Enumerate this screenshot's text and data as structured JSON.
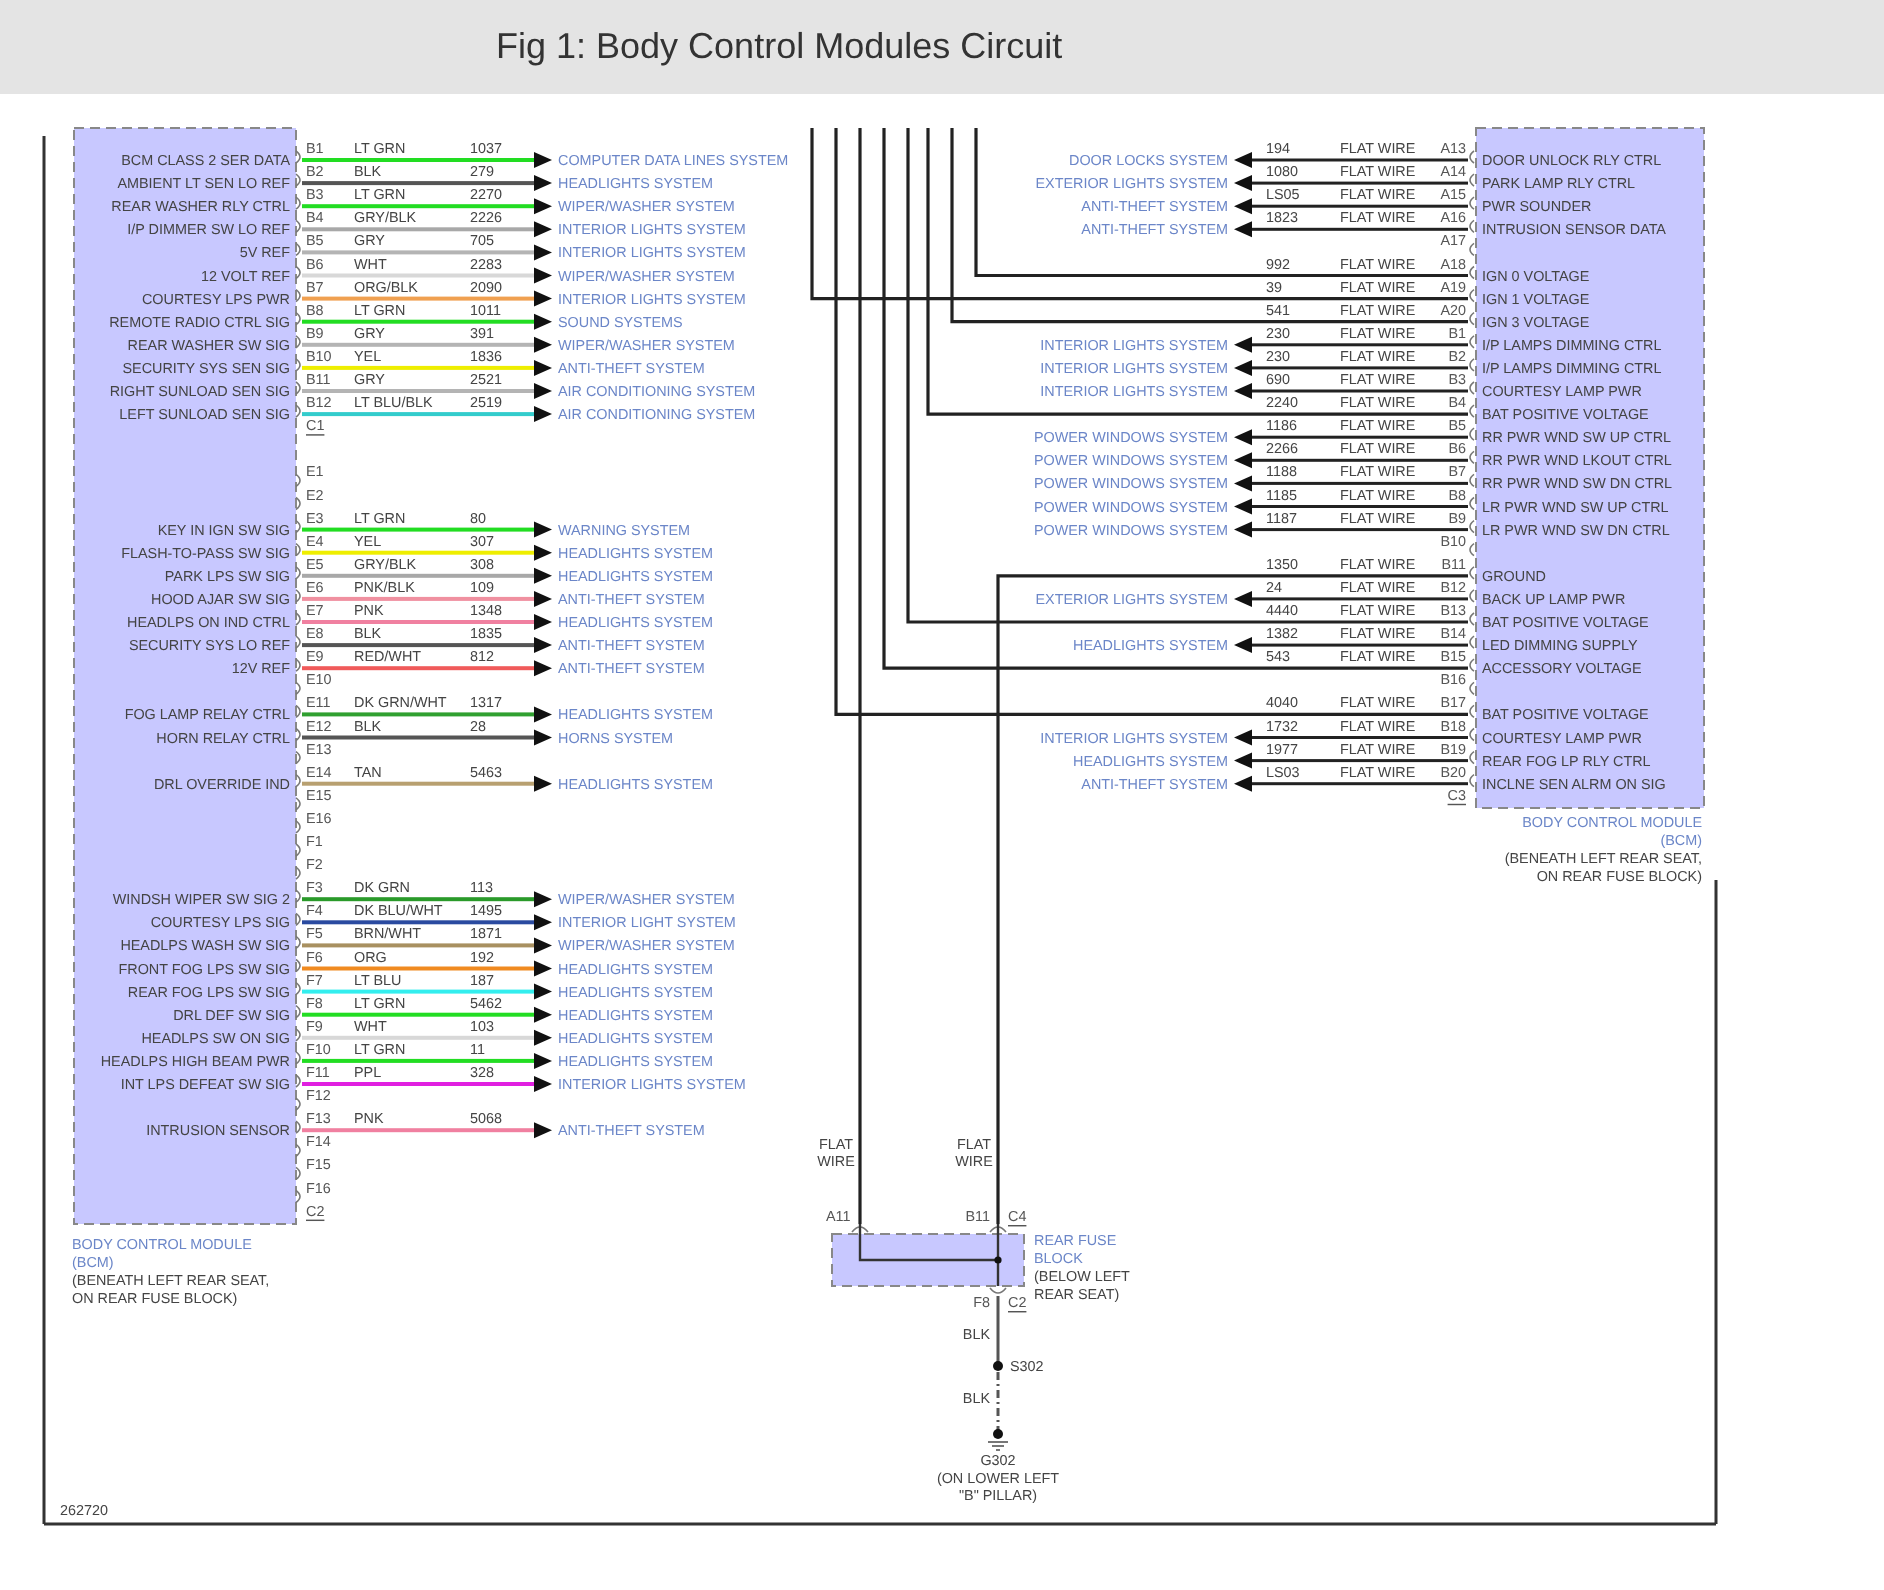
{
  "header": {
    "title": "Fig 1: Body Control Modules Circuit"
  },
  "left_module": {
    "groups": [
      {
        "connector": "C1",
        "pins": [
          {
            "pin": "B1",
            "wire_color": "LT GRN",
            "circuit": "1037",
            "signal": "BCM CLASS 2 SER DATA",
            "destination": "COMPUTER DATA LINES SYSTEM",
            "color": "#22dd22"
          },
          {
            "pin": "B2",
            "wire_color": "BLK",
            "circuit": "279",
            "signal": "AMBIENT LT SEN LO REF",
            "destination": "HEADLIGHTS SYSTEM",
            "color": "#555555"
          },
          {
            "pin": "B3",
            "wire_color": "LT GRN",
            "circuit": "2270",
            "signal": "REAR WASHER RLY CTRL",
            "destination": "WIPER/WASHER SYSTEM",
            "color": "#22dd22"
          },
          {
            "pin": "B4",
            "wire_color": "GRY/BLK",
            "circuit": "2226",
            "signal": "I/P DIMMER SW LO REF",
            "destination": "INTERIOR LIGHTS SYSTEM",
            "color": "#a8a8a8"
          },
          {
            "pin": "B5",
            "wire_color": "GRY",
            "circuit": "705",
            "signal": "5V REF",
            "destination": "INTERIOR LIGHTS SYSTEM",
            "color": "#b4b4b4"
          },
          {
            "pin": "B6",
            "wire_color": "WHT",
            "circuit": "2283",
            "signal": "12 VOLT REF",
            "destination": "WIPER/WASHER SYSTEM",
            "color": "#d8d8d8"
          },
          {
            "pin": "B7",
            "wire_color": "ORG/BLK",
            "circuit": "2090",
            "signal": "COURTESY LPS PWR",
            "destination": "INTERIOR LIGHTS SYSTEM",
            "color": "#f0a050"
          },
          {
            "pin": "B8",
            "wire_color": "LT GRN",
            "circuit": "1011",
            "signal": "REMOTE RADIO CTRL SIG",
            "destination": "SOUND SYSTEMS",
            "color": "#22dd22"
          },
          {
            "pin": "B9",
            "wire_color": "GRY",
            "circuit": "391",
            "signal": "REAR WASHER SW SIG",
            "destination": "WIPER/WASHER SYSTEM",
            "color": "#b4b4b4"
          },
          {
            "pin": "B10",
            "wire_color": "YEL",
            "circuit": "1836",
            "signal": "SECURITY SYS SEN SIG",
            "destination": "ANTI-THEFT SYSTEM",
            "color": "#eeee00"
          },
          {
            "pin": "B11",
            "wire_color": "GRY",
            "circuit": "2521",
            "signal": "RIGHT SUNLOAD SEN SIG",
            "destination": "AIR CONDITIONING SYSTEM",
            "color": "#b4b4b4"
          },
          {
            "pin": "B12",
            "wire_color": "LT BLU/BLK",
            "circuit": "2519",
            "signal": "LEFT SUNLOAD SEN SIG",
            "destination": "AIR CONDITIONING SYSTEM",
            "color": "#33cccc"
          }
        ]
      },
      {
        "connector": "C2",
        "pins": [
          {
            "pin": "E1"
          },
          {
            "pin": "E2"
          },
          {
            "pin": "E3",
            "wire_color": "LT GRN",
            "circuit": "80",
            "signal": "KEY IN IGN SW SIG",
            "destination": "WARNING SYSTEM",
            "color": "#22dd22"
          },
          {
            "pin": "E4",
            "wire_color": "YEL",
            "circuit": "307",
            "signal": "FLASH-TO-PASS SW SIG",
            "destination": "HEADLIGHTS SYSTEM",
            "color": "#eeee00"
          },
          {
            "pin": "E5",
            "wire_color": "GRY/BLK",
            "circuit": "308",
            "signal": "PARK LPS SW SIG",
            "destination": "HEADLIGHTS SYSTEM",
            "color": "#a8a8a8"
          },
          {
            "pin": "E6",
            "wire_color": "PNK/BLK",
            "circuit": "109",
            "signal": "HOOD AJAR SW SIG",
            "destination": "ANTI-THEFT SYSTEM",
            "color": "#f090a0"
          },
          {
            "pin": "E7",
            "wire_color": "PNK",
            "circuit": "1348",
            "signal": "HEADLPS ON IND CTRL",
            "destination": "HEADLIGHTS SYSTEM",
            "color": "#f080a0"
          },
          {
            "pin": "E8",
            "wire_color": "BLK",
            "circuit": "1835",
            "signal": "SECURITY SYS LO REF",
            "destination": "ANTI-THEFT SYSTEM",
            "color": "#555555"
          },
          {
            "pin": "E9",
            "wire_color": "RED/WHT",
            "circuit": "812",
            "signal": "12V REF",
            "destination": "ANTI-THEFT SYSTEM",
            "color": "#f05a5a"
          },
          {
            "pin": "E10"
          },
          {
            "pin": "E11",
            "wire_color": "DK GRN/WHT",
            "circuit": "1317",
            "signal": "FOG LAMP RELAY CTRL",
            "destination": "HEADLIGHTS SYSTEM",
            "color": "#30a030"
          },
          {
            "pin": "E12",
            "wire_color": "BLK",
            "circuit": "28",
            "signal": "HORN RELAY CTRL",
            "destination": "HORNS SYSTEM",
            "color": "#555555"
          },
          {
            "pin": "E13"
          },
          {
            "pin": "E14",
            "wire_color": "TAN",
            "circuit": "5463",
            "signal": "DRL OVERRIDE IND",
            "destination": "HEADLIGHTS SYSTEM",
            "color": "#b8a070"
          },
          {
            "pin": "E15"
          },
          {
            "pin": "E16"
          },
          {
            "pin": "F1"
          },
          {
            "pin": "F2"
          },
          {
            "pin": "F3",
            "wire_color": "DK GRN",
            "circuit": "113",
            "signal": "WINDSH WIPER SW SIG 2",
            "destination": "WIPER/WASHER SYSTEM",
            "color": "#2a9a2a"
          },
          {
            "pin": "F4",
            "wire_color": "DK BLU/WHT",
            "circuit": "1495",
            "signal": "COURTESY LPS SIG",
            "destination": "INTERIOR LIGHT SYSTEM",
            "color": "#2a4aa0"
          },
          {
            "pin": "F5",
            "wire_color": "BRN/WHT",
            "circuit": "1871",
            "signal": "HEADLPS WASH SW SIG",
            "destination": "WIPER/WASHER SYSTEM",
            "color": "#a89060"
          },
          {
            "pin": "F6",
            "wire_color": "ORG",
            "circuit": "192",
            "signal": "FRONT FOG LPS SW SIG",
            "destination": "HEADLIGHTS SYSTEM",
            "color": "#f08a20"
          },
          {
            "pin": "F7",
            "wire_color": "LT BLU",
            "circuit": "187",
            "signal": "REAR FOG LPS SW SIG",
            "destination": "HEADLIGHTS SYSTEM",
            "color": "#33eeee"
          },
          {
            "pin": "F8",
            "wire_color": "LT GRN",
            "circuit": "5462",
            "signal": "DRL DEF SW SIG",
            "destination": "HEADLIGHTS SYSTEM",
            "color": "#22dd22"
          },
          {
            "pin": "F9",
            "wire_color": "WHT",
            "circuit": "103",
            "signal": "HEADLPS SW ON SIG",
            "destination": "HEADLIGHTS SYSTEM",
            "color": "#d8d8d8"
          },
          {
            "pin": "F10",
            "wire_color": "LT GRN",
            "circuit": "11",
            "signal": "HEADLPS HIGH BEAM PWR",
            "destination": "HEADLIGHTS SYSTEM",
            "color": "#22dd22"
          },
          {
            "pin": "F11",
            "wire_color": "PPL",
            "circuit": "328",
            "signal": "INT LPS DEFEAT SW SIG",
            "destination": "INTERIOR LIGHTS SYSTEM",
            "color": "#e020e0"
          },
          {
            "pin": "F12"
          },
          {
            "pin": "F13",
            "wire_color": "PNK",
            "circuit": "5068",
            "signal": "INTRUSION SENSOR",
            "destination": "ANTI-THEFT SYSTEM",
            "color": "#f080a0"
          },
          {
            "pin": "F14"
          },
          {
            "pin": "F15"
          },
          {
            "pin": "F16"
          }
        ]
      }
    ],
    "caption": {
      "name": [
        "BODY CONTROL MODULE",
        "(BCM)"
      ],
      "location": [
        "(BENEATH LEFT REAR SEAT,",
        "ON REAR FUSE BLOCK)"
      ]
    }
  },
  "right_module": {
    "groups": [
      {
        "connector": "C3",
        "pins": [
          {
            "pin": "A13",
            "kind": "arrow",
            "circuit": "194",
            "wire": "FLAT WIRE",
            "signal": "DOOR UNLOCK RLY CTRL",
            "destination": "DOOR LOCKS SYSTEM"
          },
          {
            "pin": "A14",
            "kind": "arrow",
            "circuit": "1080",
            "wire": "FLAT WIRE",
            "signal": "PARK LAMP RLY CTRL",
            "destination": "EXTERIOR LIGHTS SYSTEM"
          },
          {
            "pin": "A15",
            "kind": "arrow",
            "circuit": "LS05",
            "wire": "FLAT WIRE",
            "signal": "PWR SOUNDER",
            "destination": "ANTI-THEFT SYSTEM"
          },
          {
            "pin": "A16",
            "kind": "arrow",
            "circuit": "1823",
            "wire": "FLAT WIRE",
            "signal": "INTRUSION SENSOR DATA",
            "destination": "ANTI-THEFT SYSTEM"
          },
          {
            "pin": "A17",
            "kind": "empty"
          },
          {
            "pin": "A18",
            "kind": "bus",
            "circuit": "992",
            "wire": "FLAT WIRE",
            "signal": "IGN 0 VOLTAGE"
          },
          {
            "pin": "A19",
            "kind": "bus",
            "circuit": "39",
            "wire": "FLAT WIRE",
            "signal": "IGN 1 VOLTAGE"
          },
          {
            "pin": "A20",
            "kind": "bus",
            "circuit": "541",
            "wire": "FLAT WIRE",
            "signal": "IGN 3 VOLTAGE"
          },
          {
            "pin": "B1",
            "kind": "arrow",
            "circuit": "230",
            "wire": "FLAT WIRE",
            "signal": "I/P LAMPS DIMMING CTRL",
            "destination": "INTERIOR LIGHTS SYSTEM"
          },
          {
            "pin": "B2",
            "kind": "arrow",
            "circuit": "230",
            "wire": "FLAT WIRE",
            "signal": "I/P LAMPS DIMMING CTRL",
            "destination": "INTERIOR LIGHTS SYSTEM"
          },
          {
            "pin": "B3",
            "kind": "arrow",
            "circuit": "690",
            "wire": "FLAT WIRE",
            "signal": "COURTESY LAMP PWR",
            "destination": "INTERIOR LIGHTS SYSTEM"
          },
          {
            "pin": "B4",
            "kind": "bus",
            "circuit": "2240",
            "wire": "FLAT WIRE",
            "signal": "BAT POSITIVE VOLTAGE"
          },
          {
            "pin": "B5",
            "kind": "arrow",
            "circuit": "1186",
            "wire": "FLAT WIRE",
            "signal": "RR PWR WND SW UP CTRL",
            "destination": "POWER WINDOWS SYSTEM"
          },
          {
            "pin": "B6",
            "kind": "arrow",
            "circuit": "2266",
            "wire": "FLAT WIRE",
            "signal": "RR PWR WND LKOUT CTRL",
            "destination": "POWER WINDOWS SYSTEM"
          },
          {
            "pin": "B7",
            "kind": "arrow",
            "circuit": "1188",
            "wire": "FLAT WIRE",
            "signal": "RR PWR WND SW DN CTRL",
            "destination": "POWER WINDOWS SYSTEM"
          },
          {
            "pin": "B8",
            "kind": "arrow",
            "circuit": "1185",
            "wire": "FLAT WIRE",
            "signal": "LR PWR WND SW UP CTRL",
            "destination": "POWER WINDOWS SYSTEM"
          },
          {
            "pin": "B9",
            "kind": "arrow",
            "circuit": "1187",
            "wire": "FLAT WIRE",
            "signal": "LR PWR WND SW DN CTRL",
            "destination": "POWER WINDOWS SYSTEM"
          },
          {
            "pin": "B10",
            "kind": "empty"
          },
          {
            "pin": "B11",
            "kind": "fuse",
            "circuit": "1350",
            "wire": "FLAT WIRE",
            "signal": "GROUND"
          },
          {
            "pin": "B12",
            "kind": "arrow",
            "circuit": "24",
            "wire": "FLAT WIRE",
            "signal": "BACK UP LAMP PWR",
            "destination": "EXTERIOR LIGHTS SYSTEM"
          },
          {
            "pin": "B13",
            "kind": "bus",
            "circuit": "4440",
            "wire": "FLAT WIRE",
            "signal": "BAT POSITIVE VOLTAGE"
          },
          {
            "pin": "B14",
            "kind": "arrow",
            "circuit": "1382",
            "wire": "FLAT WIRE",
            "signal": "LED DIMMING SUPPLY",
            "destination": "HEADLIGHTS SYSTEM"
          },
          {
            "pin": "B15",
            "kind": "bus",
            "circuit": "543",
            "wire": "FLAT WIRE",
            "signal": "ACCESSORY VOLTAGE"
          },
          {
            "pin": "B16",
            "kind": "empty"
          },
          {
            "pin": "B17",
            "kind": "bus",
            "circuit": "4040",
            "wire": "FLAT WIRE",
            "signal": "BAT POSITIVE VOLTAGE"
          },
          {
            "pin": "B18",
            "kind": "arrow",
            "circuit": "1732",
            "wire": "FLAT WIRE",
            "signal": "COURTESY LAMP PWR",
            "destination": "INTERIOR LIGHTS SYSTEM"
          },
          {
            "pin": "B19",
            "kind": "arrow",
            "circuit": "1977",
            "wire": "FLAT WIRE",
            "signal": "REAR FOG LP RLY CTRL",
            "destination": "HEADLIGHTS SYSTEM"
          },
          {
            "pin": "B20",
            "kind": "arrow",
            "circuit": "LS03",
            "wire": "FLAT WIRE",
            "signal": "INCLNE SEN ALRM ON SIG",
            "destination": "ANTI-THEFT SYSTEM"
          }
        ]
      }
    ],
    "caption": {
      "name": [
        "BODY CONTROL MODULE",
        "(BCM)"
      ],
      "location": [
        "(BENEATH LEFT REAR SEAT,",
        "ON REAR FUSE BLOCK)"
      ]
    }
  },
  "feed_wires": [
    {
      "label": [
        "FLAT",
        "WIRE"
      ]
    },
    {
      "label": [
        "FLAT",
        "WIRE"
      ]
    }
  ],
  "rear_fuse_block": {
    "input_pins": [
      "A11",
      "B11"
    ],
    "connector_top": "C4",
    "output_pin": "F8",
    "connector_bottom": "C2",
    "name": [
      "REAR FUSE",
      "BLOCK"
    ],
    "location": [
      "(BELOW LEFT",
      "REAR SEAT)"
    ]
  },
  "ground": {
    "wire_color_1": "BLK",
    "splice": "S302",
    "wire_color_2": "BLK",
    "ground": "G302",
    "location": [
      "(ON LOWER LEFT",
      "\"B\" PILLAR)"
    ]
  },
  "figure_number": "262720"
}
